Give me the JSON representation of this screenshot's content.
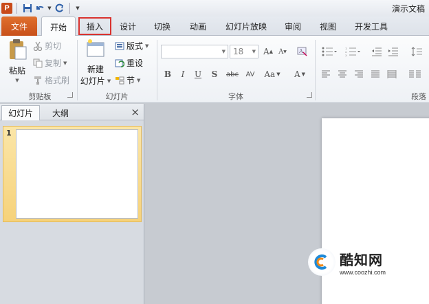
{
  "app": {
    "title": "演示文稿",
    "icon_letter": "P"
  },
  "tabs": [
    {
      "id": "file",
      "label": "文件"
    },
    {
      "id": "home",
      "label": "开始"
    },
    {
      "id": "insert",
      "label": "插入"
    },
    {
      "id": "design",
      "label": "设计"
    },
    {
      "id": "transitions",
      "label": "切换"
    },
    {
      "id": "animations",
      "label": "动画"
    },
    {
      "id": "slideshow",
      "label": "幻灯片放映"
    },
    {
      "id": "review",
      "label": "审阅"
    },
    {
      "id": "view",
      "label": "视图"
    },
    {
      "id": "developer",
      "label": "开发工具"
    }
  ],
  "ribbon": {
    "clipboard": {
      "paste": "粘贴",
      "cut": "剪切",
      "copy": "复制",
      "format_painter": "格式刷",
      "group_label": "剪贴板"
    },
    "slides": {
      "new_slide_1": "新建",
      "new_slide_2": "幻灯片",
      "layout": "版式",
      "reset": "重设",
      "section": "节",
      "group_label": "幻灯片"
    },
    "font": {
      "size_value": "18",
      "group_label": "字体"
    },
    "paragraph": {
      "group_label": "段落"
    }
  },
  "pane": {
    "tab_slides": "幻灯片",
    "tab_outline": "大纲",
    "close": "×",
    "slide_number": "1"
  },
  "watermark": {
    "title": "酷知网",
    "url": "www.coozhi.com"
  },
  "colors": {
    "file_tab": "#d2581e",
    "highlight": "#d9322e",
    "selection": "#f6d27a"
  }
}
